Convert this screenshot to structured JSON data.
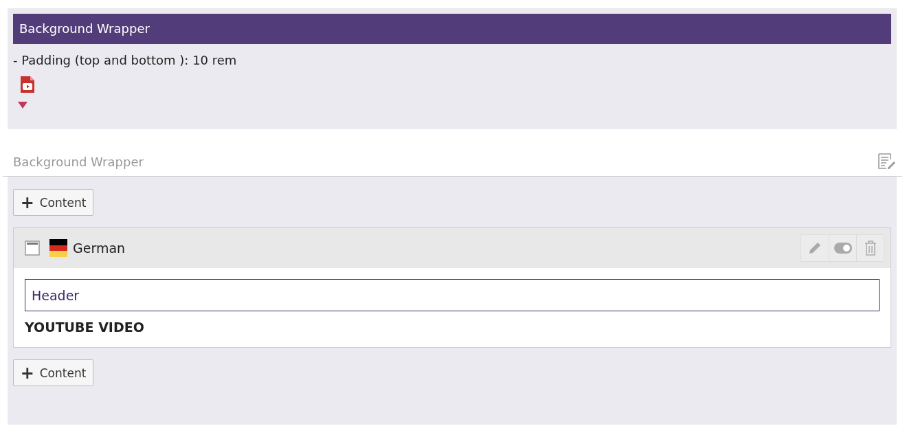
{
  "preview": {
    "title": "Background Wrapper",
    "info": "- Padding (top and bottom ): 10 rem"
  },
  "section": {
    "label": "Background Wrapper"
  },
  "add_buttons": [
    {
      "label": "Content",
      "icon": "+"
    },
    {
      "label": "Content",
      "icon": "+"
    }
  ],
  "element": {
    "language": "German",
    "header_field": {
      "value": "Header"
    },
    "type": "YOUTUBE VIDEO"
  }
}
